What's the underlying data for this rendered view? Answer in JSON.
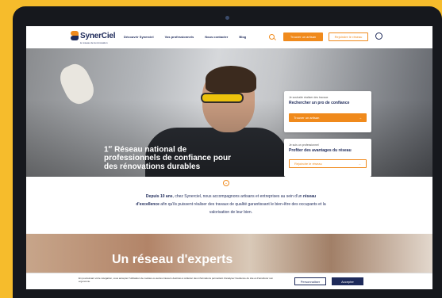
{
  "brand": {
    "name": "SynerCiel",
    "tagline": "le réseau de la rénovation"
  },
  "nav": {
    "items": [
      "Découvrir Synerciel",
      "Vos professionnels",
      "Nous contacter",
      "Blog"
    ],
    "btn_pro": "Trouver un artisan",
    "btn_join": "Rejoindre le réseau"
  },
  "hero": {
    "sup": "er",
    "num": "1",
    "title_rest": " Réseau national de professionnels de confiance pour des rénovations durables"
  },
  "card1": {
    "small": "Je souhaite réaliser des travaux",
    "big": "Rechercher un pro de confiance",
    "button": "Trouver un artisan",
    "arrow": "→"
  },
  "card2": {
    "small": "Je suis un professionnel",
    "big": "Profiter des avantages du réseau",
    "button": "Rejoindre le réseau",
    "arrow": "→"
  },
  "intro": {
    "bold1": "Depuis 10 ans",
    "text1": ", chez Synerciel, nous accompagnons artisans et entreprises au sein d'un ",
    "bold2": "réseau d'excellence",
    "text2": " afin qu'ils puissent réaliser des travaux de qualité garantissant le bien-être des occupants et la valorisation de leur bien."
  },
  "experts": {
    "title": "Un réseau d'experts"
  },
  "cookie": {
    "text": "En poursuivant votre navigation, vous acceptez l'utilisation de cookies ou autres traceurs destinés à collecter des informations permettant d'analyser l'audience du site et d'améliorer son ergonomie.",
    "customize": "Personnaliser",
    "accept": "Accepter"
  },
  "colors": {
    "accent": "#F08A1C",
    "navy": "#1E2A5A",
    "frame": "#F6BC2C"
  }
}
